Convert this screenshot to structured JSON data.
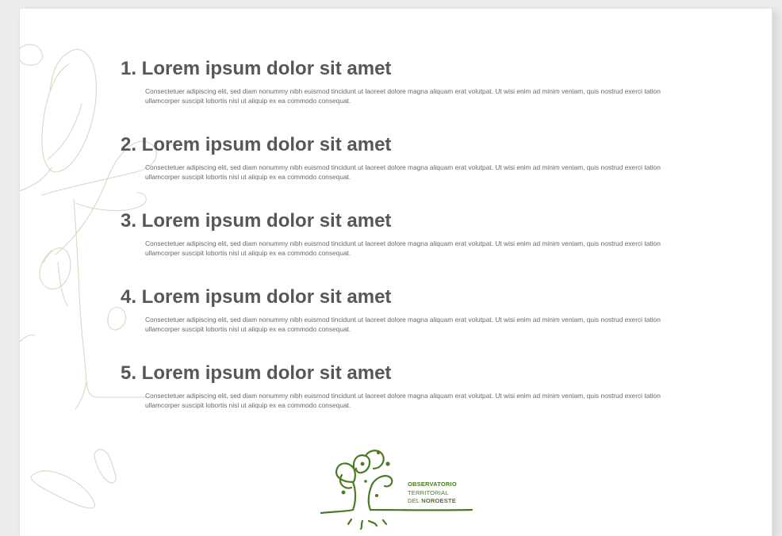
{
  "sections": [
    {
      "heading": "1. Lorem ipsum dolor sit amet",
      "body": "Consectetuer adipiscing elit, sed diam nonummy nibh euismod tincidunt ut laoreet dolore magna aliquam erat volutpat. Ut wisi enim ad minim veniam, quis nostrud exerci tation ullamcorper suscipit lobortis nisl ut aliquip ex ea commodo consequat."
    },
    {
      "heading": "2. Lorem ipsum dolor sit amet",
      "body": "Consectetuer adipiscing elit, sed diam nonummy nibh euismod tincidunt ut laoreet dolore magna aliquam erat volutpat. Ut wisi enim ad minim veniam, quis nostrud exerci tation ullamcorper suscipit lobortis nisl ut aliquip ex ea commodo consequat."
    },
    {
      "heading": "3. Lorem ipsum dolor sit amet",
      "body": "Consectetuer adipiscing elit, sed diam nonummy nibh euismod tincidunt ut laoreet dolore magna aliquam erat volutpat. Ut wisi enim ad minim veniam, quis nostrud exerci tation ullamcorper suscipit lobortis nisl ut aliquip ex ea commodo consequat."
    },
    {
      "heading": "4. Lorem ipsum dolor sit amet",
      "body": "Consectetuer adipiscing elit, sed diam nonummy nibh euismod tincidunt ut laoreet dolore magna aliquam erat volutpat. Ut wisi enim ad minim veniam, quis nostrud exerci tation ullamcorper suscipit lobortis nisl ut aliquip ex ea commodo consequat."
    },
    {
      "heading": "5. Lorem ipsum dolor sit amet",
      "body": "Consectetuer adipiscing elit, sed diam nonummy nibh euismod tincidunt ut laoreet dolore magna aliquam erat volutpat. Ut wisi enim ad minim veniam, quis nostrud exerci tation ullamcorper suscipit lobortis nisl ut aliquip ex ea commodo consequat."
    }
  ],
  "logo": {
    "line1": "OBSERVATORIO",
    "line2": "TERRITORIAL",
    "line3_prefix": "DEL ",
    "line3_bold": "NOROESTE"
  },
  "colors": {
    "heading": "#575757",
    "body_text": "#6a6a6a",
    "logo_green": "#4a7a22",
    "decoration_line": "#ddd6c0"
  },
  "icons": {
    "background": "tree-line-art-decoration",
    "logo": "tree-logo-icon"
  }
}
